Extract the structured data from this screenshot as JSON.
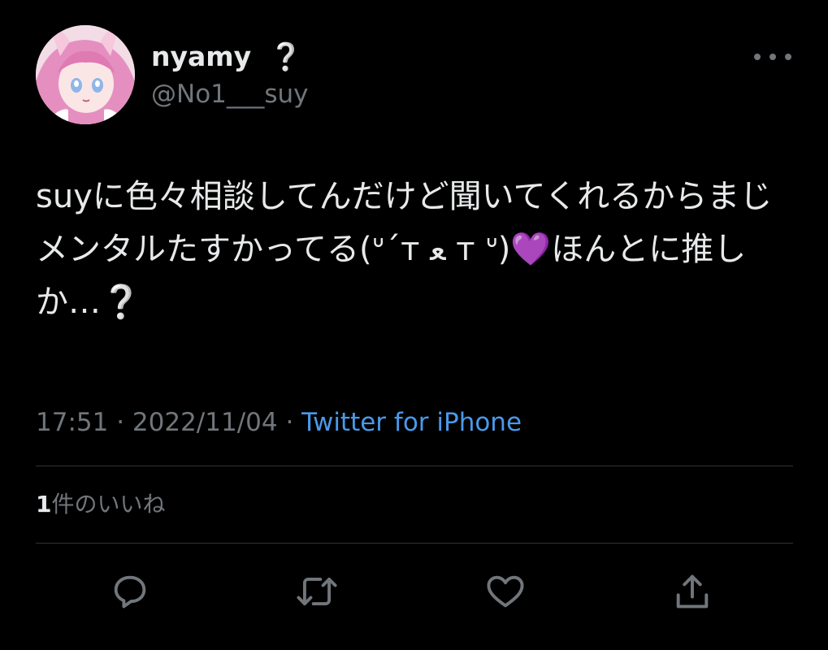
{
  "author": {
    "display_name": "nyamy",
    "name_badge": "❔",
    "handle": "@No1___suy"
  },
  "tweet": {
    "text": "suyに色々相談してんだけど聞いてくれるからまじメンタルたすかってる(ᐡ´т ﻌ т ᐡ)💜ほんとに推しか…❔",
    "time": "17:51",
    "separator": " · ",
    "date": "2022/11/04",
    "source": "Twitter for iPhone"
  },
  "stats": {
    "like_count": "1",
    "like_label": "件のいいね"
  },
  "icons": {
    "more": "more-horizontal-icon",
    "reply": "reply-icon",
    "retweet": "retweet-icon",
    "like": "heart-icon",
    "share": "share-icon"
  },
  "colors": {
    "background": "#000000",
    "text": "#e7e9ea",
    "secondary": "#71767b",
    "link": "#4a99e9",
    "divider": "#2f3336"
  }
}
